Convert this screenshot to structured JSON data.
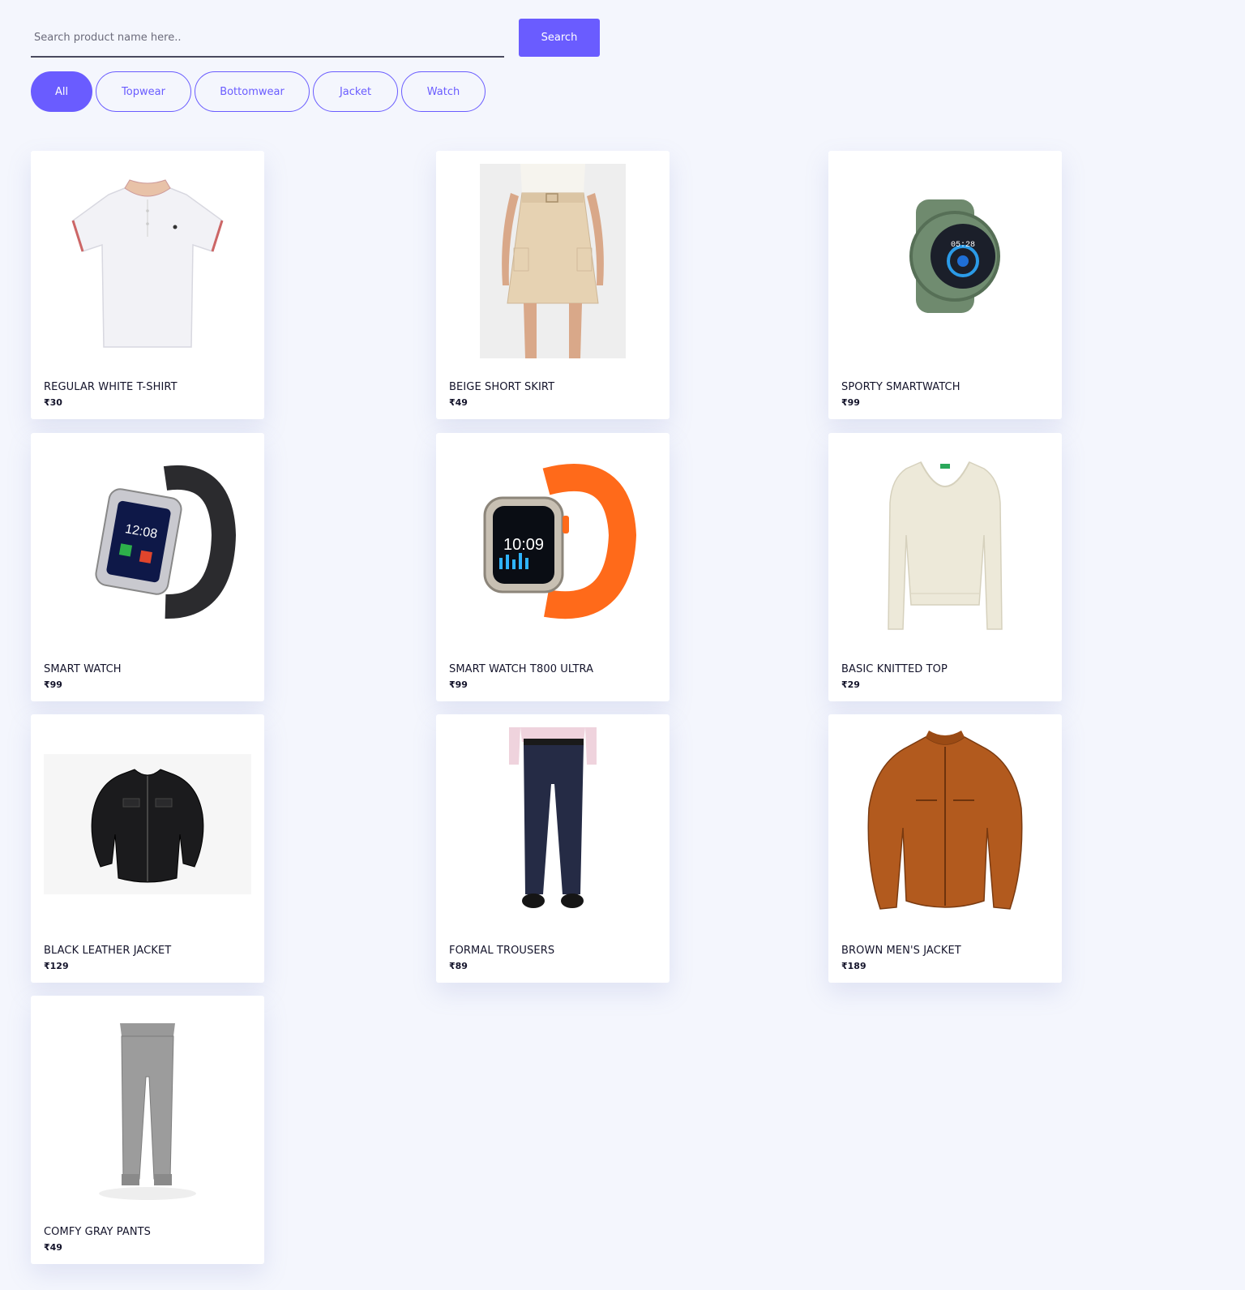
{
  "search": {
    "placeholder": "Search product name here..",
    "button_label": "Search"
  },
  "filters": [
    {
      "label": "All",
      "active": true
    },
    {
      "label": "Topwear",
      "active": false
    },
    {
      "label": "Bottomwear",
      "active": false
    },
    {
      "label": "Jacket",
      "active": false
    },
    {
      "label": "Watch",
      "active": false
    }
  ],
  "colors": {
    "accent": "#6a5cff",
    "background": "#f4f6fd",
    "card": "#ffffff",
    "text": "#14142b"
  },
  "products": [
    {
      "name": "REGULAR WHITE T-SHIRT",
      "price": "₹30",
      "icon": "white-polo-tshirt-image"
    },
    {
      "name": "BEIGE SHORT SKIRT",
      "price": "₹49",
      "icon": "beige-skirt-image"
    },
    {
      "name": "SPORTY SMARTWATCH",
      "price": "₹99",
      "icon": "green-smartwatch-image"
    },
    {
      "name": "SMART WATCH",
      "price": "₹99",
      "icon": "black-smartwatch-image"
    },
    {
      "name": "SMART WATCH T800 ULTRA",
      "price": "₹99",
      "icon": "orange-smartwatch-image"
    },
    {
      "name": "BASIC KNITTED TOP",
      "price": "₹29",
      "icon": "cream-knitted-top-image"
    },
    {
      "name": "BLACK LEATHER JACKET",
      "price": "₹129",
      "icon": "black-leather-jacket-image"
    },
    {
      "name": "FORMAL TROUSERS",
      "price": "₹89",
      "icon": "formal-trousers-image"
    },
    {
      "name": "BROWN MEN'S JACKET",
      "price": "₹189",
      "icon": "brown-leather-jacket-image"
    },
    {
      "name": "COMFY GRAY PANTS",
      "price": "₹49",
      "icon": "gray-pants-image"
    }
  ]
}
